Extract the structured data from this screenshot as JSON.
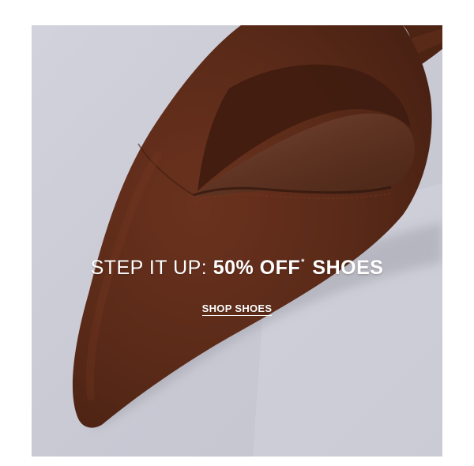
{
  "promo": {
    "headline_light": "STEP IT UP: ",
    "headline_bold": "50% OFF",
    "footnote_mark": "*",
    "headline_tail": " SHOES",
    "cta_label": "SHOP SHOES"
  },
  "colors": {
    "background": "#ffffff",
    "hero_backdrop": "#cdcdd8",
    "shoe_suede": "#5e2c1a",
    "text": "#ffffff"
  },
  "image": {
    "subject": "brown suede pointed-toe slingback shoe"
  }
}
